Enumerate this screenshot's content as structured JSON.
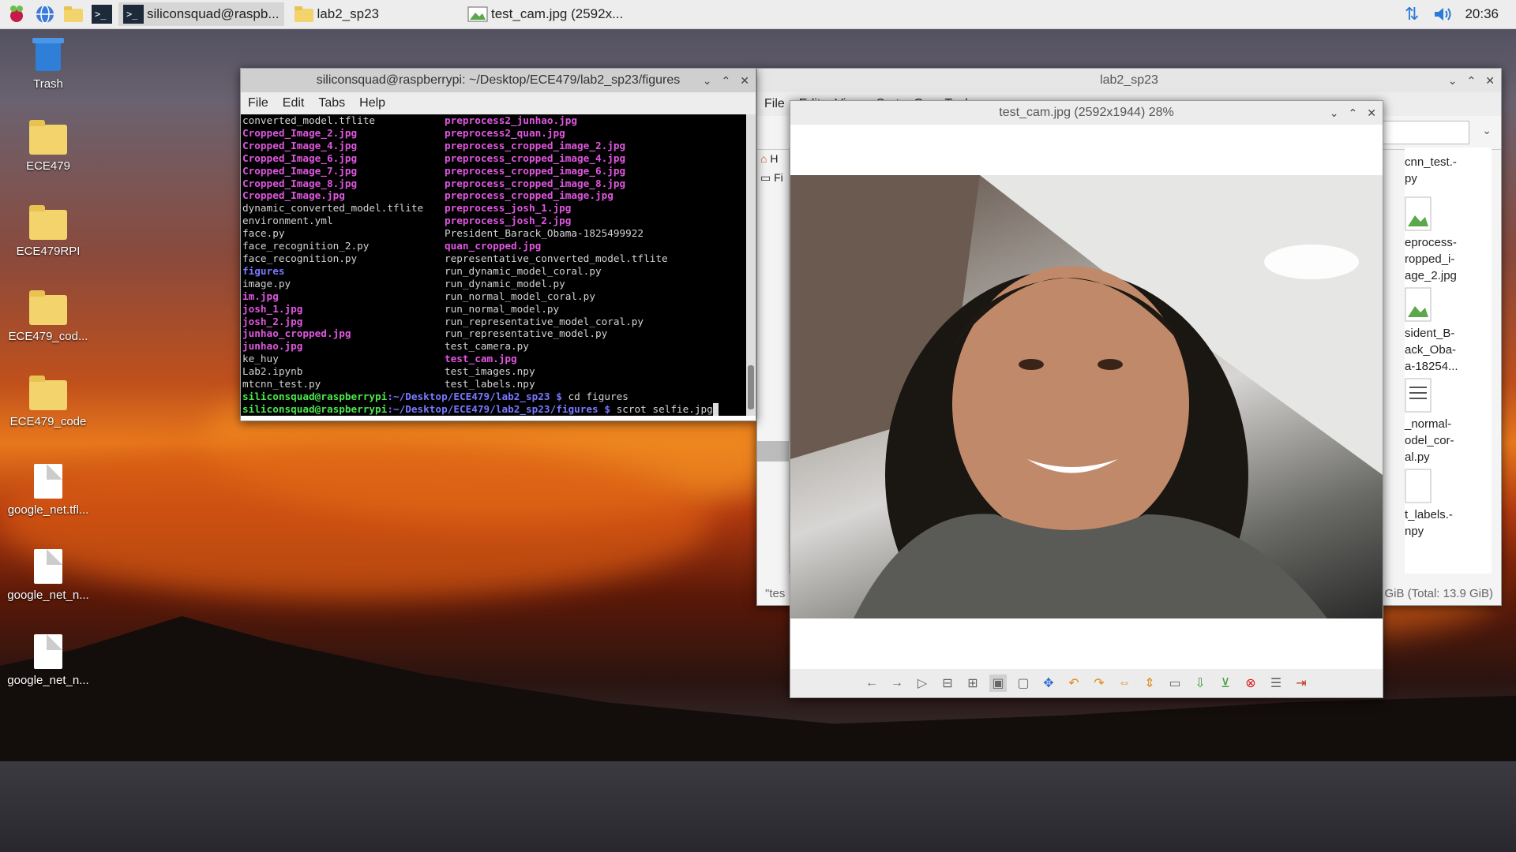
{
  "taskbar": {
    "buttons": [
      {
        "label": "siliconsquad@raspb..."
      },
      {
        "label": "lab2_sp23"
      },
      {
        "label": "test_cam.jpg (2592x..."
      }
    ],
    "clock": "20:36"
  },
  "desktop": {
    "icons": [
      {
        "label": "Trash"
      },
      {
        "label": "ECE479"
      },
      {
        "label": "ECE479RPI"
      },
      {
        "label": "ECE479_cod..."
      },
      {
        "label": "ECE479_code"
      },
      {
        "label": "google_net.tfl..."
      },
      {
        "label": "google_net_n..."
      },
      {
        "label": "google_net_n..."
      }
    ]
  },
  "terminal": {
    "title": "siliconsquad@raspberrypi: ~/Desktop/ECE479/lab2_sp23/figures",
    "menu": [
      "File",
      "Edit",
      "Tabs",
      "Help"
    ],
    "rows": [
      [
        "converted_model.tflite",
        "preprocess2_junhao.jpg"
      ],
      [
        "Cropped_Image_2.jpg",
        "preprocess2_quan.jpg"
      ],
      [
        "Cropped_Image_4.jpg",
        "preprocess_cropped_image_2.jpg"
      ],
      [
        "Cropped_Image_6.jpg",
        "preprocess_cropped_image_4.jpg"
      ],
      [
        "Cropped_Image_7.jpg",
        "preprocess_cropped_image_6.jpg"
      ],
      [
        "Cropped_Image_8.jpg",
        "preprocess_cropped_image_8.jpg"
      ],
      [
        "Cropped_Image.jpg",
        "preprocess_cropped_image.jpg"
      ],
      [
        "dynamic_converted_model.tflite",
        "preprocess_josh_1.jpg"
      ],
      [
        "environment.yml",
        "preprocess_josh_2.jpg"
      ],
      [
        "face.py",
        "President_Barack_Obama-1825499922"
      ],
      [
        "face_recognition_2.py",
        "quan_cropped.jpg"
      ],
      [
        "face_recognition.py",
        "representative_converted_model.tflite"
      ],
      [
        "figures",
        "run_dynamic_model_coral.py"
      ],
      [
        "image.py",
        "run_dynamic_model.py"
      ],
      [
        "im.jpg",
        "run_normal_model_coral.py"
      ],
      [
        "josh_1.jpg",
        "run_normal_model.py"
      ],
      [
        "josh_2.jpg",
        "run_representative_model_coral.py"
      ],
      [
        "junhao_cropped.jpg",
        "run_representative_model.py"
      ],
      [
        "junhao.jpg",
        "test_camera.py"
      ],
      [
        "ke_huy",
        "test_cam.jpg"
      ],
      [
        "Lab2.ipynb",
        "test_images.npy"
      ],
      [
        "mtcnn_test.py",
        "test_labels.npy"
      ]
    ],
    "prompt1": {
      "user": "siliconsquad@raspberrypi",
      "path": ":~/Desktop/ECE479/lab2_sp23 $",
      "cmd": " cd figures"
    },
    "prompt2": {
      "user": "siliconsquad@raspberrypi",
      "path": ":~/Desktop/ECE479/lab2_sp23/figures $",
      "cmd": " scrot selfie.jpg"
    }
  },
  "filemanager": {
    "title": "lab2_sp23",
    "menu": [
      "File",
      "Edit",
      "View",
      "Sort",
      "Go",
      "Tools"
    ],
    "side": [
      "H",
      "Fi"
    ],
    "items": [
      {
        "label": "cnn_test.-\npy"
      },
      {
        "label": "eprocess-\nropped_i-\nage_2.jpg"
      },
      {
        "label": "sident_B-\nack_Oba-\na-18254..."
      },
      {
        "label": "_normal-\nodel_cor-\nal.py"
      },
      {
        "label": "t_labels.-\nnpy"
      }
    ],
    "status_left": "\"tes",
    "status_right": "GiB (Total: 13.9 GiB)"
  },
  "viewer": {
    "title": "test_cam.jpg (2592x1944) 28%"
  }
}
